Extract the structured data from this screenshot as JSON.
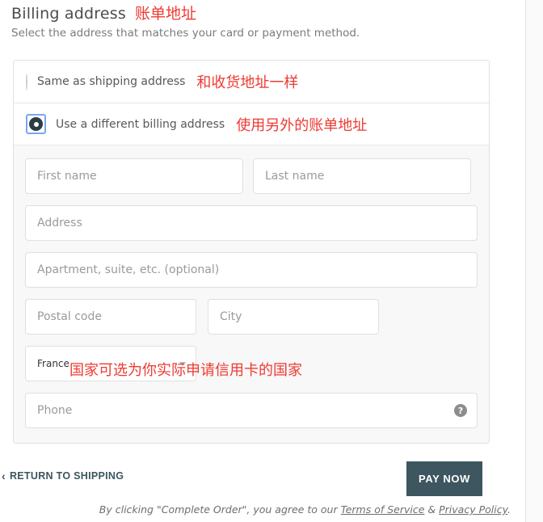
{
  "page": {
    "title": "Billing address",
    "title_annotation": "账单地址",
    "subtitle": "Select the address that matches your card or payment method.",
    "annotation_color": "#ee3a32"
  },
  "billing_options": [
    {
      "label": "Same as shipping address",
      "annotation": "和收货地址一样",
      "selected": false
    },
    {
      "label": "Use a different billing address",
      "annotation": "使用另外的账单地址",
      "selected": true
    }
  ],
  "form": {
    "first_name_placeholder": "First name",
    "last_name_placeholder": "Last name",
    "address_placeholder": "Address",
    "apartment_placeholder": "Apartment, suite, etc. (optional)",
    "postal_code_placeholder": "Postal code",
    "city_placeholder": "City",
    "country_value": "France",
    "country_annotation": "国家可选为你实际申请信用卡的国家",
    "phone_placeholder": "Phone",
    "phone_help_glyph": "?"
  },
  "footer": {
    "return_link": "RETURN TO SHIPPING",
    "return_chevron": "‹",
    "pay_now_label": "PAY NOW",
    "legal_prefix": "By clicking \"Complete Order\", you agree to our ",
    "terms_link": "Terms of Service",
    "legal_separator": " & ",
    "privacy_link": "Privacy Policy",
    "legal_suffix": ".",
    "pay_button_color": "#3d565f"
  }
}
